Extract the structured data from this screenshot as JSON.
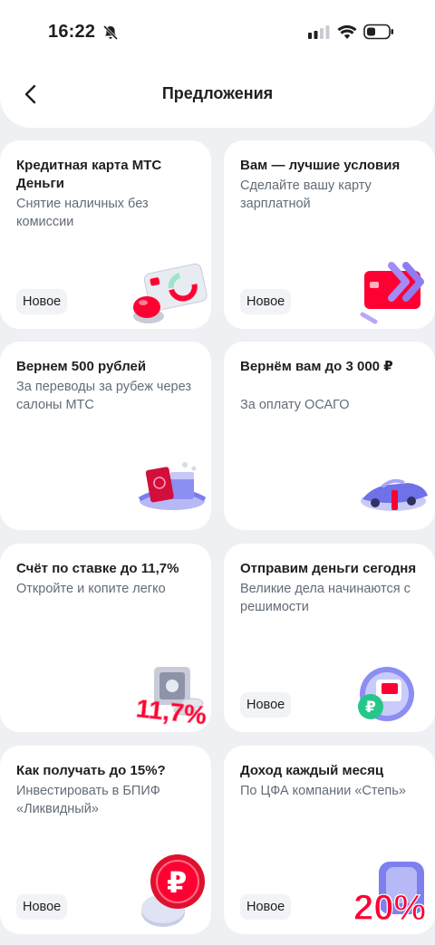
{
  "status_bar": {
    "time": "16:22"
  },
  "header": {
    "title": "Предложения"
  },
  "offers": [
    {
      "title": "Кредитная карта МТС Деньги",
      "subtitle": "Снятие наличных без комиссии",
      "badge": "Новое",
      "illustration": "credit-card-icon"
    },
    {
      "title": "Вам — лучшие условия",
      "subtitle": "Сделайте вашу карту зарплатной",
      "badge": "Новое",
      "illustration": "salary-card-icon"
    },
    {
      "title": "Вернем 500 рублей",
      "subtitle": "За переводы за рубеж через салоны МТС",
      "badge": "",
      "illustration": "passport-icon"
    },
    {
      "title": "Вернём вам до 3 000 ₽",
      "subtitle": "За оплату ОСАГО",
      "badge": "",
      "illustration": "car-insurance-icon"
    },
    {
      "title": "Счёт по ставке до 11,7%",
      "subtitle": "Откройте и копите легко",
      "badge": "",
      "illustration": "safe-percent-icon"
    },
    {
      "title": "Отправим деньги сегодня",
      "subtitle": "Великие дела начинаются с решимости",
      "badge": "Новое",
      "illustration": "money-transfer-icon"
    },
    {
      "title": "Как получать до 15%?",
      "subtitle": "Инвестировать в БПИФ «Ликвидный»",
      "badge": "Новое",
      "illustration": "ruble-coin-icon"
    },
    {
      "title": "Доход каждый месяц",
      "subtitle": "По ЦФА компании «Степь»",
      "badge": "Новое",
      "illustration": "twenty-percent-icon"
    }
  ],
  "illustration_texts": {
    "rate": "11,7%",
    "percent20": "20%"
  },
  "colors": {
    "accent": "#ff0032",
    "background": "#eef0f4",
    "card": "#ffffff",
    "violet": "#7b7cf0"
  }
}
